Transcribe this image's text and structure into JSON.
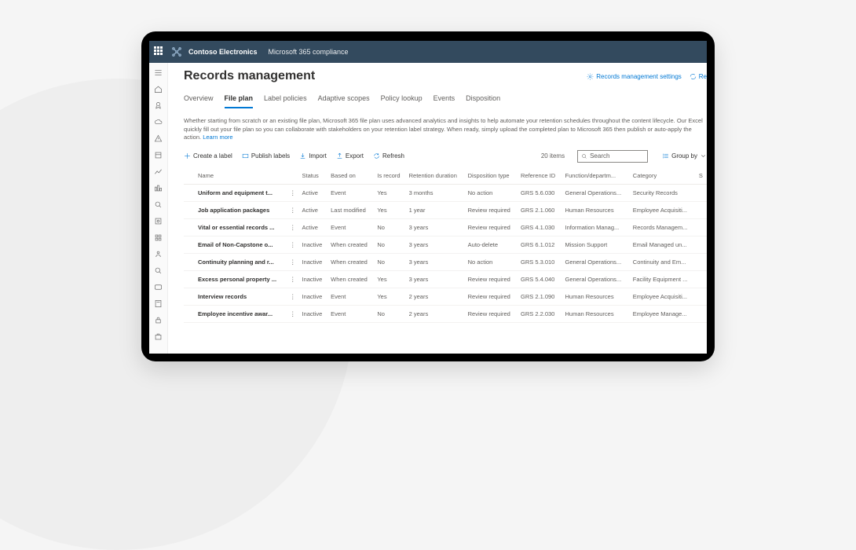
{
  "header": {
    "org": "Contoso Electronics",
    "suite": "Microsoft 365 compliance"
  },
  "page": {
    "title": "Records management",
    "settings_link": "Records management settings",
    "refresh_link": "Re"
  },
  "tabs": [
    {
      "label": "Overview"
    },
    {
      "label": "File plan",
      "active": true
    },
    {
      "label": "Label policies"
    },
    {
      "label": "Adaptive scopes"
    },
    {
      "label": "Policy lookup"
    },
    {
      "label": "Events"
    },
    {
      "label": "Disposition"
    }
  ],
  "description": {
    "text": "Whether starting from scratch or an existing file plan, Microsoft 365 file plan uses advanced analytics and insights to help automate your retention schedules throughout the content lifecycle. Our Excel quickly fill out your file plan so you can collaborate with stakeholders on your retention label strategy. When ready, simply upload the completed plan to Microsoft 365 then publish or auto-apply the action.",
    "learn_more": "Learn more"
  },
  "toolbar": {
    "create": "Create a label",
    "publish": "Publish labels",
    "import": "Import",
    "export": "Export",
    "refresh": "Refresh",
    "item_count": "20 items",
    "search_placeholder": "Search",
    "group_by": "Group by"
  },
  "columns": {
    "name": "Name",
    "status": "Status",
    "based_on": "Based on",
    "is_record": "Is record",
    "retention": "Retention duration",
    "disposition": "Disposition type",
    "reference": "Reference ID",
    "function": "Function/departm...",
    "category": "Category",
    "s": "S"
  },
  "rows": [
    {
      "name": "Uniform and equipment t...",
      "status": "Active",
      "based_on": "Event",
      "is_record": "Yes",
      "retention": "3 months",
      "disposition": "No action",
      "reference": "GRS 5.6.030",
      "function": "General Operations...",
      "category": "Security Records"
    },
    {
      "name": "Job application packages",
      "status": "Active",
      "based_on": "Last modified",
      "is_record": "Yes",
      "retention": "1 year",
      "disposition": "Review required",
      "reference": "GRS 2.1.060",
      "function": "Human Resources",
      "category": "Employee Acquisiti..."
    },
    {
      "name": "Vital or essential records ...",
      "status": "Active",
      "based_on": "Event",
      "is_record": "No",
      "retention": "3 years",
      "disposition": "Review required",
      "reference": "GRS 4.1.030",
      "function": "Information Manag...",
      "category": "Records Managem..."
    },
    {
      "name": "Email of Non-Capstone o...",
      "status": "Inactive",
      "based_on": "When created",
      "is_record": "No",
      "retention": "3 years",
      "disposition": "Auto-delete",
      "reference": "GRS 6.1.012",
      "function": "Mission Support",
      "category": "Email Managed un..."
    },
    {
      "name": "Continuity planning and r...",
      "status": "Inactive",
      "based_on": "When created",
      "is_record": "No",
      "retention": "3 years",
      "disposition": "No action",
      "reference": "GRS 5.3.010",
      "function": "General Operations...",
      "category": "Continuity and Em..."
    },
    {
      "name": "Excess personal property ...",
      "status": "Inactive",
      "based_on": "When created",
      "is_record": "Yes",
      "retention": "3 years",
      "disposition": "Review required",
      "reference": "GRS 5.4.040",
      "function": "General Operations...",
      "category": "Facility Equipment ..."
    },
    {
      "name": "Interview records",
      "status": "Inactive",
      "based_on": "Event",
      "is_record": "Yes",
      "retention": "2 years",
      "disposition": "Review required",
      "reference": "GRS 2.1.090",
      "function": "Human Resources",
      "category": "Employee Acquisiti..."
    },
    {
      "name": "Employee incentive awar...",
      "status": "Inactive",
      "based_on": "Event",
      "is_record": "No",
      "retention": "2 years",
      "disposition": "Review required",
      "reference": "GRS 2.2.030",
      "function": "Human Resources",
      "category": "Employee Manage..."
    }
  ]
}
